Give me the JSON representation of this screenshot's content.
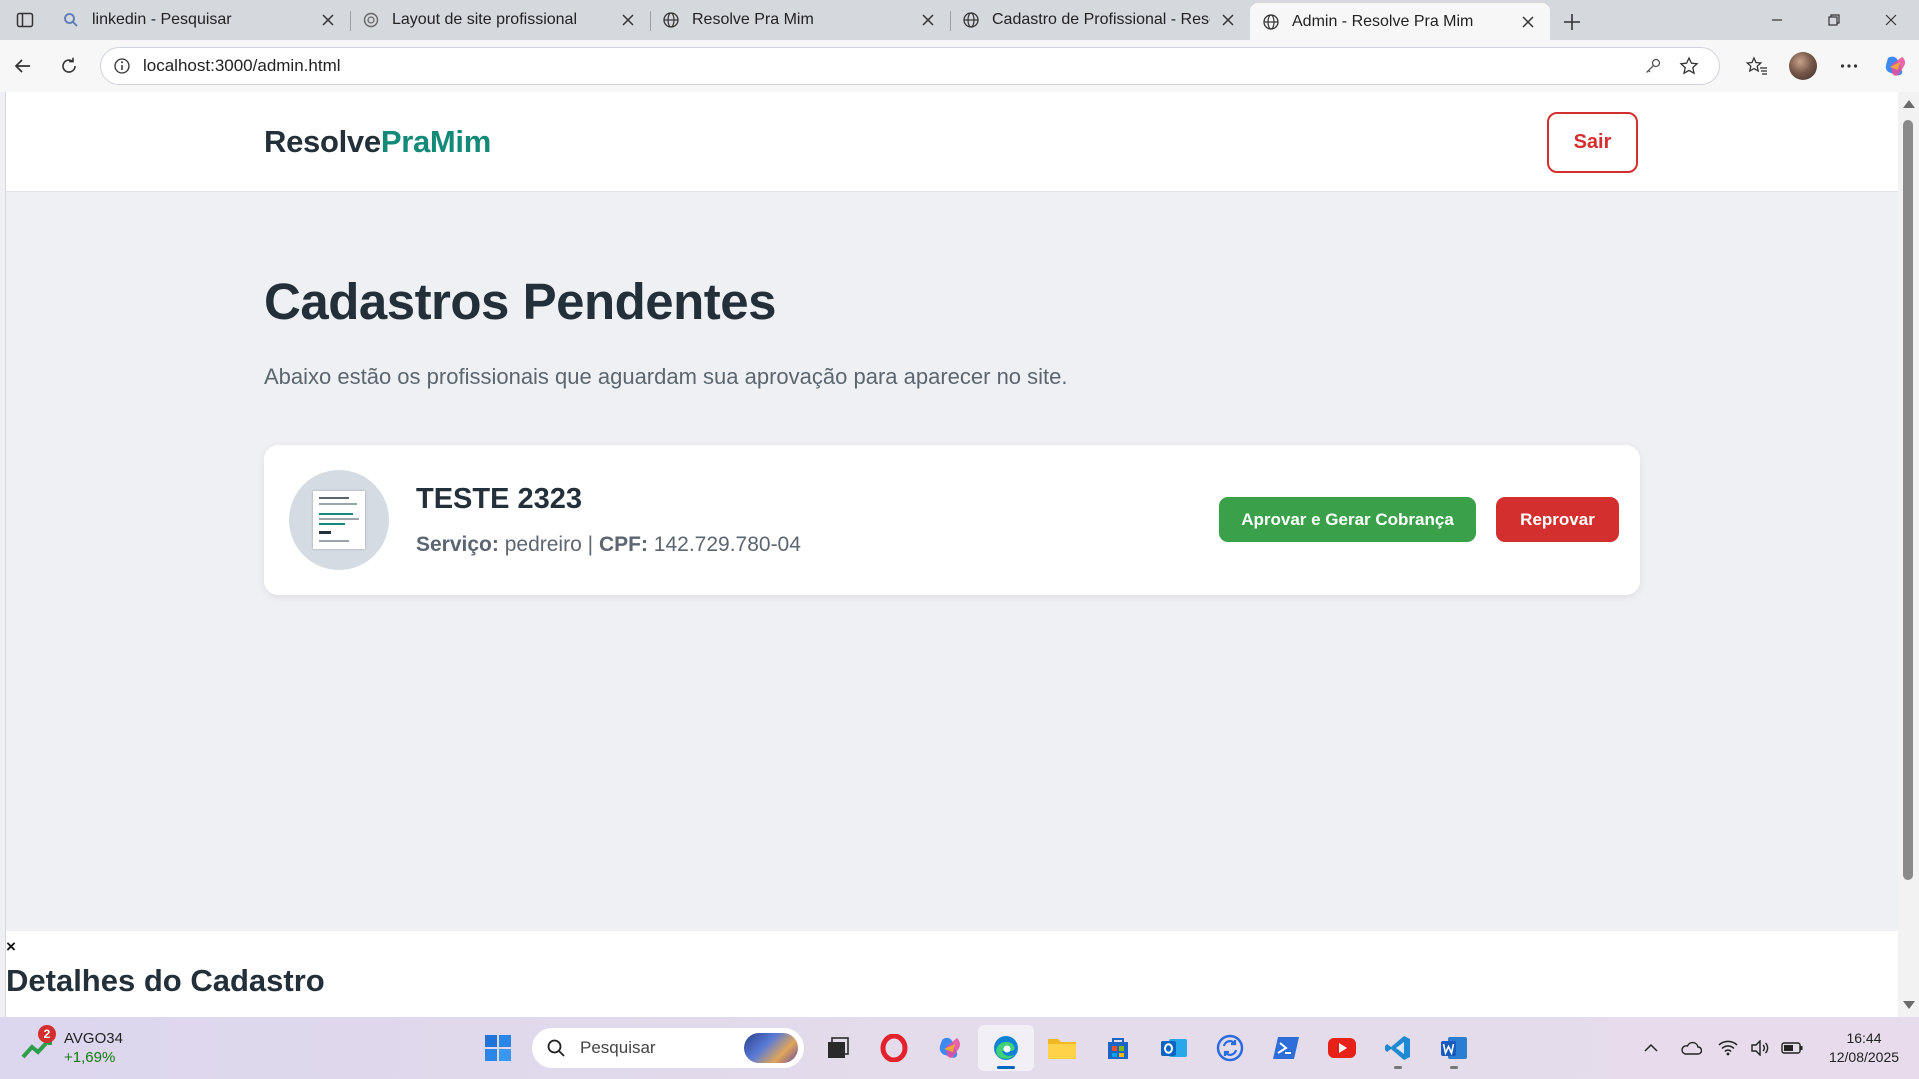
{
  "browser": {
    "tabs": [
      {
        "title": "linkedin - Pesquisar",
        "favicon": "search-icon",
        "active": false
      },
      {
        "title": "Layout de site profissional",
        "favicon": "chatgpt-icon",
        "active": false
      },
      {
        "title": "Resolve Pra Mim",
        "favicon": "globe-icon",
        "active": false
      },
      {
        "title": "Cadastro de Profissional - Resolve Pra Mim",
        "favicon": "globe-icon",
        "active": false
      },
      {
        "title": "Admin - Resolve Pra Mim",
        "favicon": "globe-icon",
        "active": true
      }
    ],
    "url": "localhost:3000/admin.html"
  },
  "site": {
    "logo_part1": "Resolve",
    "logo_part2": "PraMim",
    "logout_label": "Sair",
    "page_title": "Cadastros Pendentes",
    "page_subtitle": "Abaixo estão os profissionais que aguardam sua aprovação para aparecer no site.",
    "pending": [
      {
        "name": "TESTE 2323",
        "service_label": "Serviço:",
        "service": "pedreiro",
        "separator": "|",
        "cpf_label": "CPF:",
        "cpf": "142.729.780-04",
        "approve_label": "Aprovar e Gerar Cobrança",
        "reject_label": "Reprovar"
      }
    ],
    "details": {
      "close_symbol": "×",
      "title": "Detalhes do Cadastro"
    }
  },
  "taskbar": {
    "stock_symbol": "AVGO34",
    "stock_change": "+1,69%",
    "stock_badge": "2",
    "search_placeholder": "Pesquisar",
    "time": "16:44",
    "date": "12/08/2025"
  },
  "colors": {
    "brand_dark": "#23303a",
    "brand_accent": "#138a77",
    "approve": "#3aa14a",
    "reject": "#d32f2f"
  }
}
